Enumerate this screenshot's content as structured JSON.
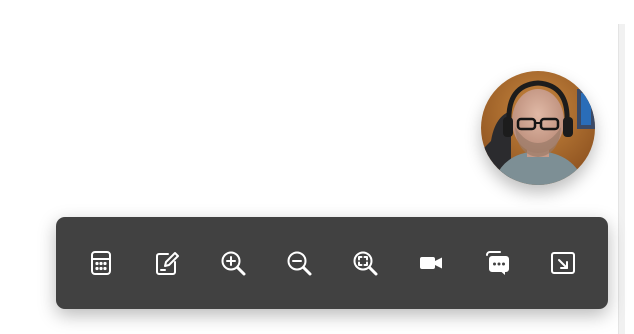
{
  "camera": {
    "kind": "webcam-video-bubble"
  },
  "toolbar": {
    "background": "#414141",
    "icon_color": "#ffffff",
    "buttons": [
      {
        "icon": "calculator-icon"
      },
      {
        "icon": "edit-note-icon"
      },
      {
        "icon": "zoom-in-icon"
      },
      {
        "icon": "zoom-out-icon"
      },
      {
        "icon": "zoom-fit-icon"
      },
      {
        "icon": "video-camera-icon"
      },
      {
        "icon": "chat-bubble-icon"
      },
      {
        "icon": "picture-in-picture-exit-icon"
      }
    ]
  }
}
